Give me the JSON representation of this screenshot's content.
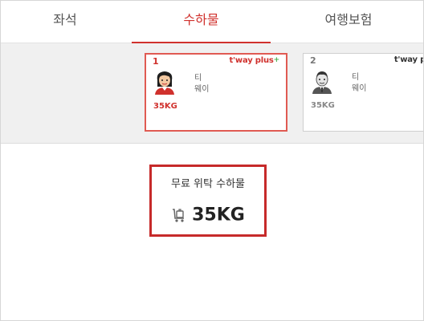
{
  "tabs": [
    {
      "label": "좌석",
      "active": false
    },
    {
      "label": "수하물",
      "active": true
    },
    {
      "label": "여행보험",
      "active": false
    }
  ],
  "passengers": [
    {
      "number": "1",
      "brand": "t'way plus",
      "brand_plus": "+",
      "name_line1": "티",
      "name_line2": "웨이",
      "baggage": "35KG",
      "selected": true,
      "avatar": "female-passenger-icon"
    },
    {
      "number": "2",
      "brand": "t'way plus",
      "brand_plus": "",
      "name_line1": "티",
      "name_line2": "웨이",
      "baggage": "35KG",
      "selected": false,
      "avatar": "male-passenger-icon"
    }
  ],
  "baggage_summary": {
    "title": "무료 위탁 수하물",
    "weight": "35KG",
    "icon": "luggage-cart-icon"
  },
  "colors": {
    "accent": "#d0312d",
    "highlight_border": "#c62a2a",
    "plus_green": "#4caf50"
  }
}
